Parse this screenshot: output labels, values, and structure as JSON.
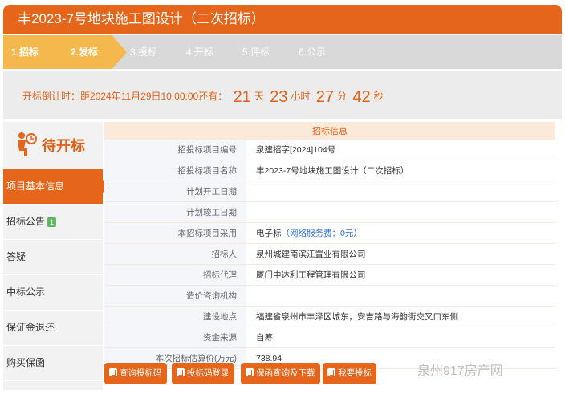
{
  "title": "丰2023-7号地块施工图设计（二次招标）",
  "steps": [
    "1.招标",
    "2.发标",
    "3.投标",
    "4.开标",
    "5.评标",
    "6.公示"
  ],
  "countdown": {
    "prefix": "开标倒计时：距2024年11月29日10:00:00还有：",
    "days": "21",
    "days_unit": "天",
    "hours": "23",
    "hours_unit": "小时",
    "minutes": "27",
    "minutes_unit": "分",
    "seconds": "42",
    "seconds_unit": "秒"
  },
  "status": "待开标",
  "menu": [
    {
      "label": "项目基本信息",
      "active": true
    },
    {
      "label": "招标公告",
      "badge": "1"
    },
    {
      "label": "答疑"
    },
    {
      "label": "中标公示"
    },
    {
      "label": "保证金退还"
    },
    {
      "label": "购买保函"
    }
  ],
  "info": {
    "caption": "招标信息",
    "rows": [
      {
        "label": "招投标项目编号",
        "value": "泉建招字[2024]104号"
      },
      {
        "label": "招投标项目名称",
        "value": "丰2023-7号地块施工图设计（二次招标）"
      },
      {
        "label": "计划开工日期",
        "value": ""
      },
      {
        "label": "计划竣工日期",
        "value": ""
      },
      {
        "label": "本招标项目采用",
        "value": "电子标",
        "extra": "（网络服务费：0元）"
      },
      {
        "label": "招标人",
        "value": "泉州城建南滨江置业有限公司"
      },
      {
        "label": "招标代理",
        "value": "厦门中达利工程管理有限公司"
      },
      {
        "label": "造价咨询机构",
        "value": ""
      },
      {
        "label": "建设地点",
        "value": "福建省泉州市丰泽区城东，安吉路与海韵街交叉口东侧"
      },
      {
        "label": "资金来源",
        "value": "自筹"
      },
      {
        "label": "本次招标估算价(万元)",
        "value": "738.94"
      }
    ]
  },
  "buttons": [
    "查询投标码",
    "投标码登录",
    "保函查询及下载",
    "我要投标"
  ],
  "watermark": "泉州917房产网",
  "colors": {
    "accent": "#e5651a",
    "step_active": "#f4b84c",
    "badge": "#5cb85c",
    "link": "#2a6ecf"
  }
}
